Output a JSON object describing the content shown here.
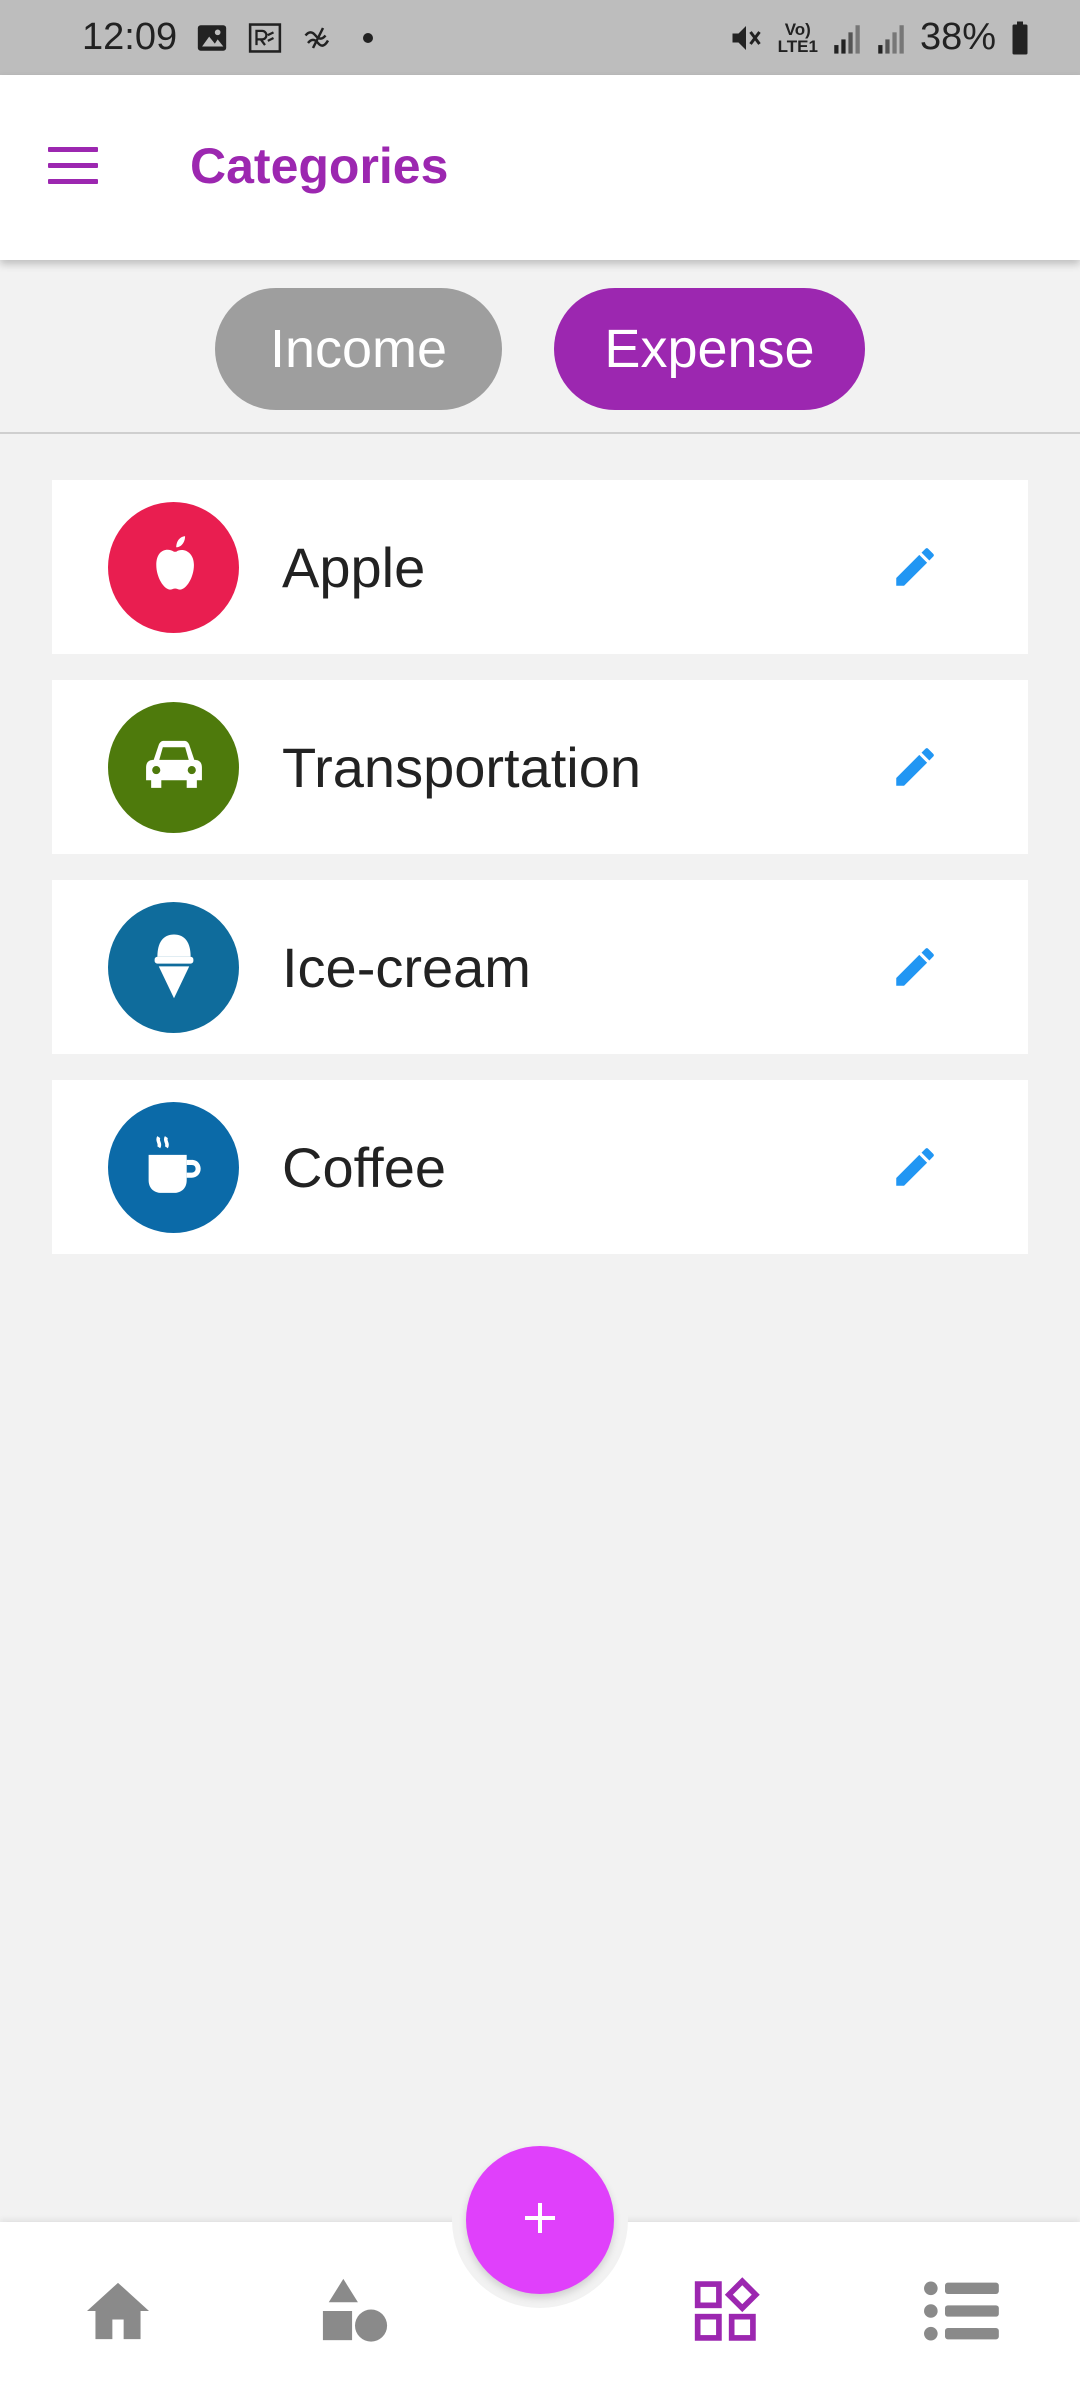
{
  "status_bar": {
    "time": "12:09",
    "lte_top": "Vo)",
    "lte_bottom": "LTE1",
    "battery_percent": "38%",
    "icons": [
      "image-icon",
      "r-icon",
      "wave-icon",
      "dot-icon",
      "mute-icon",
      "signal-icon",
      "signal-icon",
      "battery-icon"
    ]
  },
  "app_bar": {
    "title": "Categories",
    "menu_icon": "hamburger-menu-icon"
  },
  "tabs": {
    "income_label": "Income",
    "expense_label": "Expense",
    "selected": "Expense",
    "colors": {
      "selected": "#9c27b0",
      "unselected": "#9e9e9e"
    }
  },
  "categories": [
    {
      "label": "Apple",
      "icon": "apple-icon",
      "color": "#e91e50"
    },
    {
      "label": "Transportation",
      "icon": "car-icon",
      "color": "#4e7a0c"
    },
    {
      "label": "Ice-cream",
      "icon": "ice-cream-icon",
      "color": "#0f6c9c"
    },
    {
      "label": "Coffee",
      "icon": "coffee-icon",
      "color": "#0b6aa8"
    }
  ],
  "edit_icon_color": "#2196f3",
  "fab": {
    "icon": "plus-icon",
    "color": "#e040fb"
  },
  "bottom_nav": {
    "items": [
      {
        "icon": "home-icon",
        "active": false
      },
      {
        "icon": "shapes-icon",
        "active": false
      },
      {
        "icon": "categories-icon",
        "active": true
      },
      {
        "icon": "list-icon",
        "active": false
      }
    ],
    "active_color": "#9c27b0",
    "inactive_color": "#8a8a8a"
  }
}
